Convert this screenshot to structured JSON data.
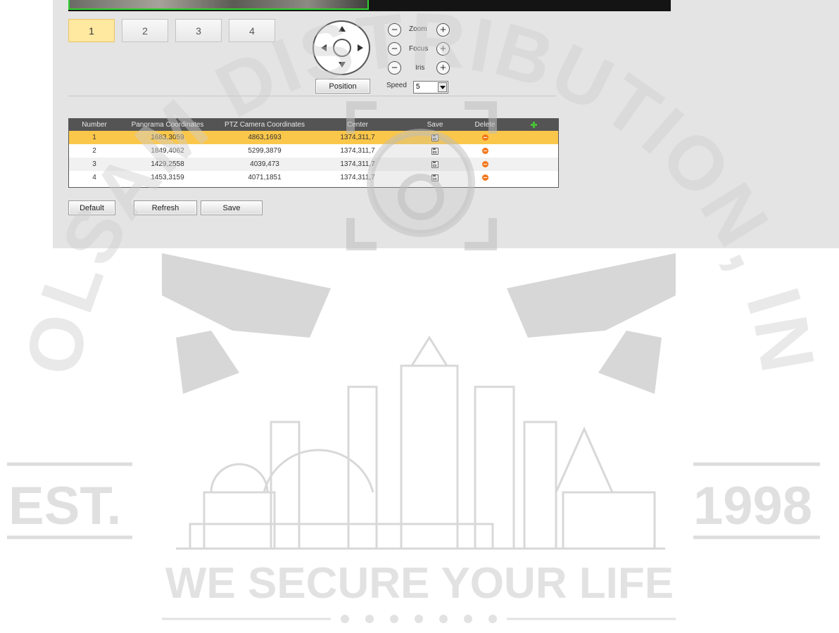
{
  "tabs": [
    {
      "label": "1",
      "active": true
    },
    {
      "label": "2",
      "active": false
    },
    {
      "label": "3",
      "active": false
    },
    {
      "label": "4",
      "active": false
    }
  ],
  "ptz": {
    "position_label": "Position",
    "zoom_label": "Zoom",
    "focus_label": "Focus",
    "iris_label": "Iris",
    "minus": "−",
    "plus": "+",
    "speed_label": "Speed",
    "speed_value": "5"
  },
  "table": {
    "headers": {
      "number": "Number",
      "panorama": "Panorama Coordinates",
      "ptz": "PTZ Camera Coordinates",
      "center": "Center",
      "save": "Save",
      "delete": "Delete"
    },
    "rows": [
      {
        "number": "1",
        "panorama": "1683,3059",
        "ptz": "4863,1693",
        "center": "1374,311,7",
        "selected": true
      },
      {
        "number": "2",
        "panorama": "1849,4062",
        "ptz": "5299,3879",
        "center": "1374,311,7",
        "selected": false
      },
      {
        "number": "3",
        "panorama": "1429,2558",
        "ptz": "4039,473",
        "center": "1374,311,7",
        "selected": false
      },
      {
        "number": "4",
        "panorama": "1453,3159",
        "ptz": "4071,1851",
        "center": "1374,311,7",
        "selected": false
      }
    ]
  },
  "actions": {
    "default_label": "Default",
    "refresh_label": "Refresh",
    "save_label": "Save"
  },
  "watermark": {
    "arc_text": "COLSAM DISTRIBUTION, INC",
    "est": "EST.",
    "year": "1998",
    "slogan": "WE SECURE YOUR LIFE"
  },
  "colors": {
    "selected_row": "#fbc74a",
    "active_tab": "#ffe8a0",
    "header_bg": "#545454",
    "delete_icon": "#f2781c",
    "add_icon": "#46c235",
    "video_border": "#2fd12f"
  }
}
